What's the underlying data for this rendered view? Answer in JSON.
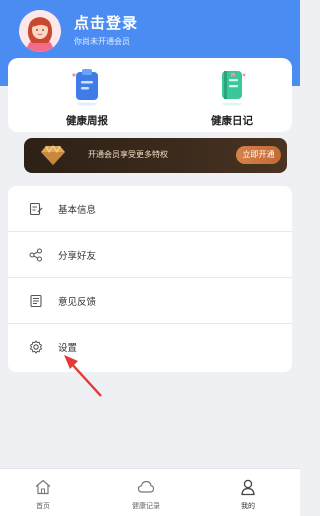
{
  "header": {
    "login_title": "点击登录",
    "login_subtitle": "你尚未开通会员",
    "accent": "#4b8cf2"
  },
  "quick_actions": [
    {
      "label": "健康周报",
      "icon": "clipboard-report-icon"
    },
    {
      "label": "健康日记",
      "icon": "notebook-icon"
    }
  ],
  "vip": {
    "text": "开通会员享受更多特权",
    "button": "立即开通"
  },
  "menu": [
    {
      "label": "基本信息",
      "icon": "edit-document-icon"
    },
    {
      "label": "分享好友",
      "icon": "share-icon"
    },
    {
      "label": "意见反馈",
      "icon": "feedback-icon"
    },
    {
      "label": "设置",
      "icon": "gear-icon"
    }
  ],
  "tabs": [
    {
      "label": "首页",
      "icon": "home-icon"
    },
    {
      "label": "健康记录",
      "icon": "cloud-icon"
    },
    {
      "label": "我的",
      "icon": "user-icon"
    }
  ]
}
